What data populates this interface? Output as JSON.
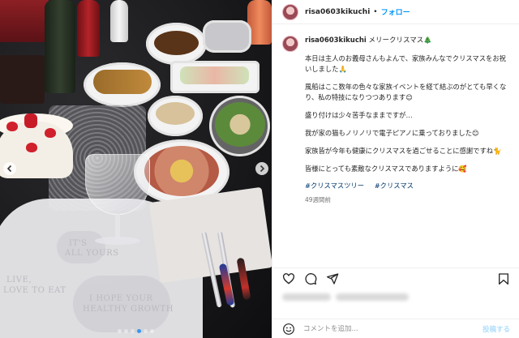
{
  "post": {
    "username": "risa0603kikuchi",
    "separator": "•",
    "follow_label": "フォロー",
    "caption_title": "メリークリスマス🎄",
    "caption_paragraphs": [
      "本日は主人のお義母さんもよんで、家族みんなでクリスマスをお祝いしました🙏",
      "風船はここ数年の色々な家族イベントを経て結ぶのがとても早くなり、私の特技になりつつあります😊",
      "盛り付けは少々苦手なままですが…",
      "我が家の猫もノリノリで電子ピアノに乗っておりました😊",
      "家族皆が今年も健康にクリスマスを過ごせることに感謝ですね🐈",
      "皆様にとっても素敵なクリスマスでありますように🥰"
    ],
    "hashtags": [
      "#クリスマスツリー",
      "#クリスマス"
    ],
    "time_ago": "49週間前"
  },
  "photo": {
    "placemat_text": [
      "IT'S",
      "ALL YOURS",
      "LIVE,",
      "LOVE TO EAT",
      "I HOPE YOUR",
      "HEALTHY GROWTH"
    ],
    "prev_icon": "chevron-left-icon",
    "next_icon": "chevron-right-icon",
    "dots_count": 6,
    "active_dot": 3
  },
  "actions": {
    "icons": [
      "heart-icon",
      "comment-icon",
      "share-icon",
      "bookmark-icon"
    ]
  },
  "comment": {
    "placeholder": "コメントを追加...",
    "post_label": "投稿する",
    "icon": "emoji-icon"
  },
  "colors": {
    "accent": "#0095f6",
    "hashtag": "#00376b",
    "muted": "#737373",
    "post_disabled": "#b2dffc"
  }
}
